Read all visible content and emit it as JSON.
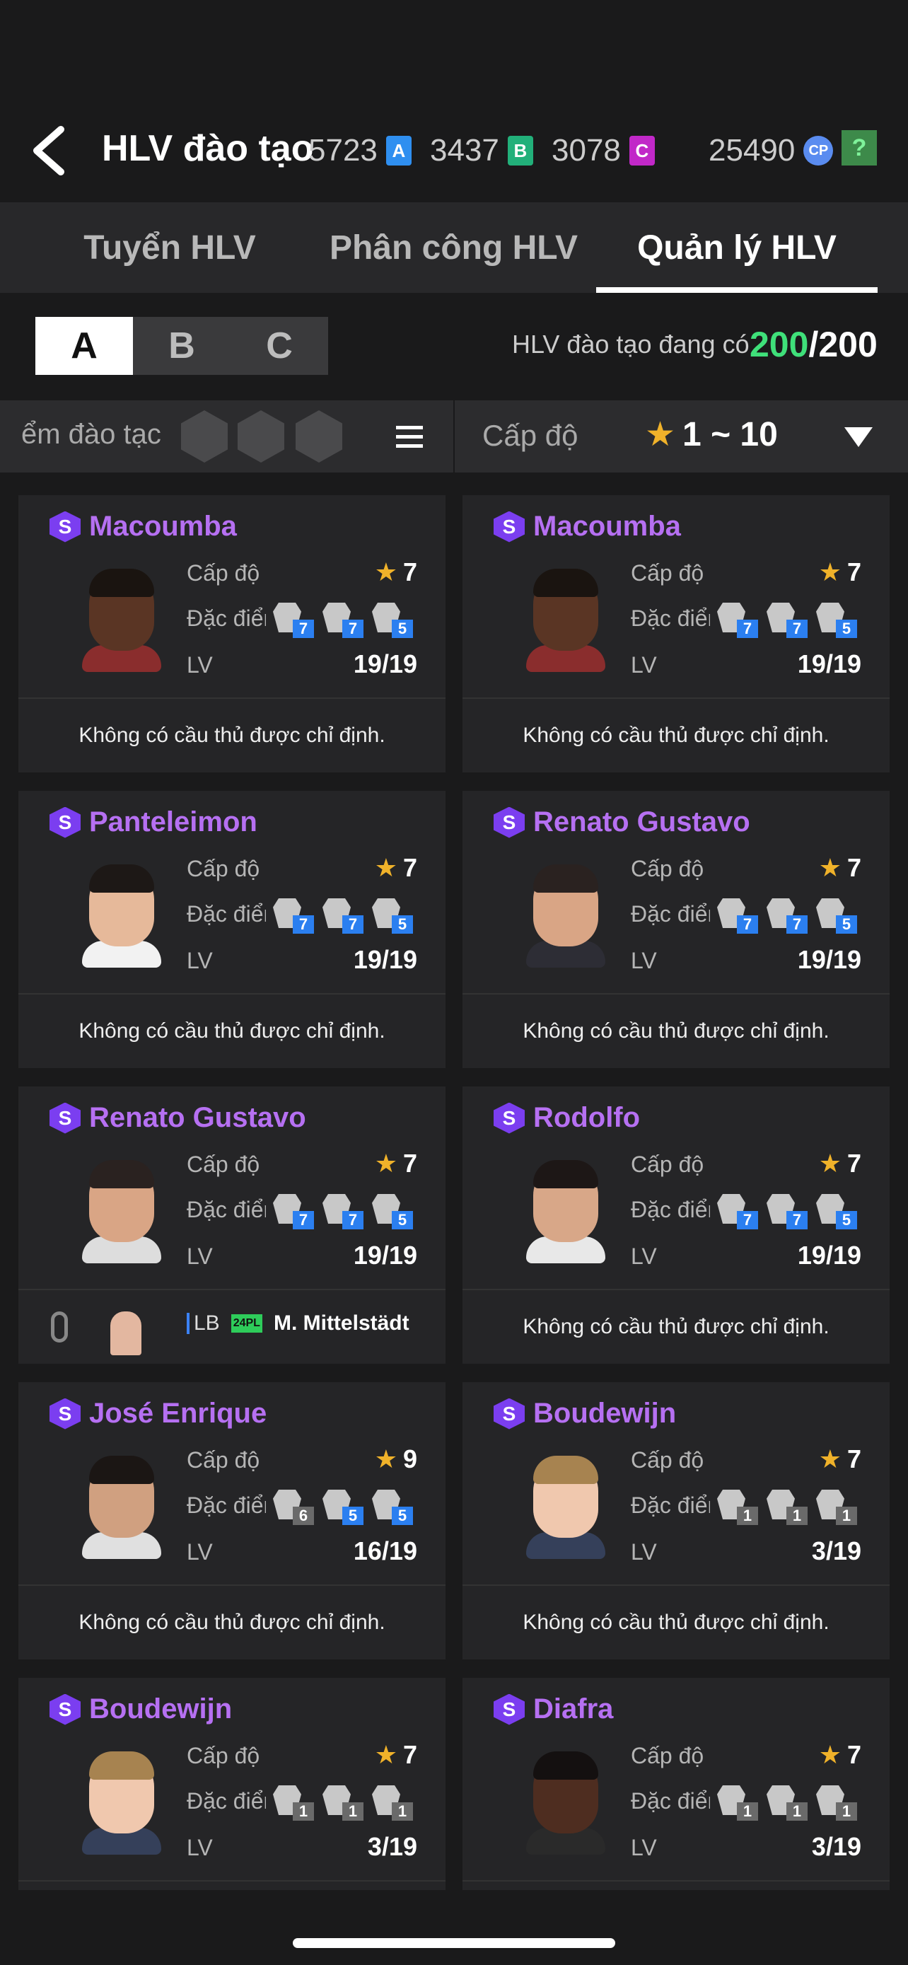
{
  "header": {
    "title": "HLV đào tạo",
    "currencies": [
      {
        "value": "5723",
        "badge": "A",
        "color": "#2f8ff0"
      },
      {
        "value": "3437",
        "badge": "B",
        "color": "#22b07a"
      },
      {
        "value": "3078",
        "badge": "C",
        "color": "#c128c8"
      }
    ],
    "cp_value": "25490",
    "cp_badge": "CP",
    "help": "?"
  },
  "tabs": [
    {
      "label": "Tuyển HLV",
      "active": false
    },
    {
      "label": "Phân công HLV",
      "active": false
    },
    {
      "label": "Quản lý HLV",
      "active": true
    }
  ],
  "groups": [
    "A",
    "B",
    "C"
  ],
  "active_group": "A",
  "coach_count": {
    "label": "HLV đào tạo đang có",
    "current": "200",
    "max": "/200"
  },
  "filter": {
    "sort_label": "ểm đào tạc",
    "level_label": "Cấp độ",
    "level_range": "1 ~ 10"
  },
  "labels": {
    "level": "Cấp độ",
    "traits": "Đặc điểm",
    "traits_cut": "Đặc điểm",
    "lv": "LV"
  },
  "cards": [
    {
      "name": "Macoumba",
      "tier": "S",
      "level": "7",
      "lv": "19/19",
      "traits": [
        "7",
        "7",
        "5"
      ],
      "assigned": "Không có cầu thủ được chỉ định.",
      "skin": "#5a3524",
      "hair": "#1a1410",
      "shirt": "#8a2d2d"
    },
    {
      "name": "Macoumba",
      "tier": "S",
      "level": "7",
      "lv": "19/19",
      "traits": [
        "7",
        "7",
        "5"
      ],
      "assigned": "Không có cầu thủ được chỉ định.",
      "skin": "#5a3524",
      "hair": "#1a1410",
      "shirt": "#8a2d2d"
    },
    {
      "name": "Panteleimon",
      "tier": "S",
      "level": "7",
      "lv": "19/19",
      "traits": [
        "7",
        "7",
        "5"
      ],
      "assigned": "Không có cầu thủ được chỉ định.",
      "skin": "#e6b99a",
      "hair": "#1d1816",
      "shirt": "#f2f2f2"
    },
    {
      "name": "Renato Gustavo",
      "tier": "S",
      "level": "7",
      "lv": "19/19",
      "traits": [
        "7",
        "7",
        "5"
      ],
      "assigned": "Không có cầu thủ được chỉ định.",
      "skin": "#d9a585",
      "hair": "#2a2220",
      "shirt": "#2d2d35"
    },
    {
      "name": "Renato Gustavo",
      "tier": "S",
      "level": "7",
      "lv": "19/19",
      "traits": [
        "7",
        "7",
        "5"
      ],
      "assigned": "",
      "skin": "#d9a585",
      "hair": "#2a2220",
      "shirt": "#dddddd"
    },
    {
      "name": "Rodolfo",
      "tier": "S",
      "level": "7",
      "lv": "19/19",
      "traits": [
        "7",
        "7",
        "5"
      ],
      "assigned": "Không có cầu thủ được chỉ định.",
      "skin": "#d8a788",
      "hair": "#1d1716",
      "shirt": "#e8e8e8"
    },
    {
      "name": "José Enrique",
      "tier": "S",
      "level": "9",
      "lv": "16/19",
      "traits": [
        "6",
        "5",
        "5"
      ],
      "assigned": "Không có cầu thủ được chỉ định.",
      "skin": "#d0a080",
      "hair": "#1b1614",
      "shirt": "#e0e0e0"
    },
    {
      "name": "Boudewijn",
      "tier": "S",
      "level": "7",
      "lv": "3/19",
      "traits": [
        "1",
        "1",
        "1"
      ],
      "assigned": "Không có cầu thủ được chỉ định.",
      "skin": "#f0c8ae",
      "hair": "#a78350",
      "shirt": "#35405a"
    },
    {
      "name": "Boudewijn",
      "tier": "S",
      "level": "7",
      "lv": "3/19",
      "traits": [
        "1",
        "1",
        "1"
      ],
      "assigned": "",
      "skin": "#f0c8ae",
      "hair": "#a78350",
      "shirt": "#35405a"
    },
    {
      "name": "Diafra",
      "tier": "S",
      "level": "7",
      "lv": "3/19",
      "traits": [
        "1",
        "1",
        "1"
      ],
      "assigned": "",
      "skin": "#4e2d20",
      "hair": "#141010",
      "shirt": "#2a2a2a"
    }
  ],
  "linked_player": {
    "position": "LB",
    "season": "24PL",
    "name": "M. Mittelstädt"
  }
}
